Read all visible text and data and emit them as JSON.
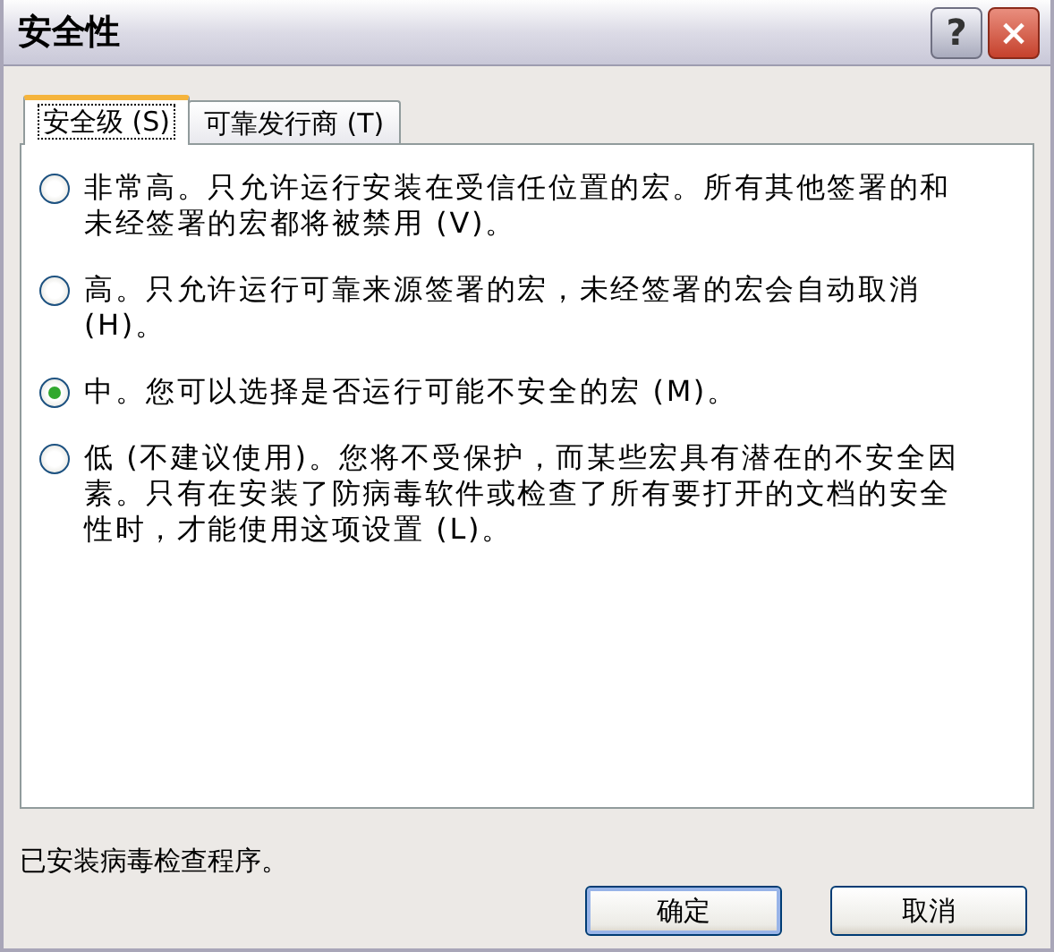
{
  "window": {
    "title": "安全性",
    "help_button": "?",
    "close_button": "×"
  },
  "tabs": [
    {
      "label": "安全级 (S)",
      "selected": true
    },
    {
      "label": "可靠发行商 (T)",
      "selected": false
    }
  ],
  "options": [
    {
      "label": "非常高。只允许运行安装在受信任位置的宏。所有其他签署的和未经签署的宏都将被禁用 (V)。",
      "selected": false
    },
    {
      "label": "高。只允许运行可靠来源签署的宏，未经签署的宏会自动取消 (H)。",
      "selected": false
    },
    {
      "label": "中。您可以选择是否运行可能不安全的宏 (M)。",
      "selected": true
    },
    {
      "label": "低 (不建议使用)。您将不受保护，而某些宏具有潜在的不安全因素。只有在安装了防病毒软件或检查了所有要打开的文档的安全性时，才能使用这项设置 (L)。",
      "selected": false
    }
  ],
  "status": "已安装病毒检查程序。",
  "buttons": [
    {
      "label": "确定",
      "default": true
    },
    {
      "label": "取消",
      "default": false
    }
  ]
}
